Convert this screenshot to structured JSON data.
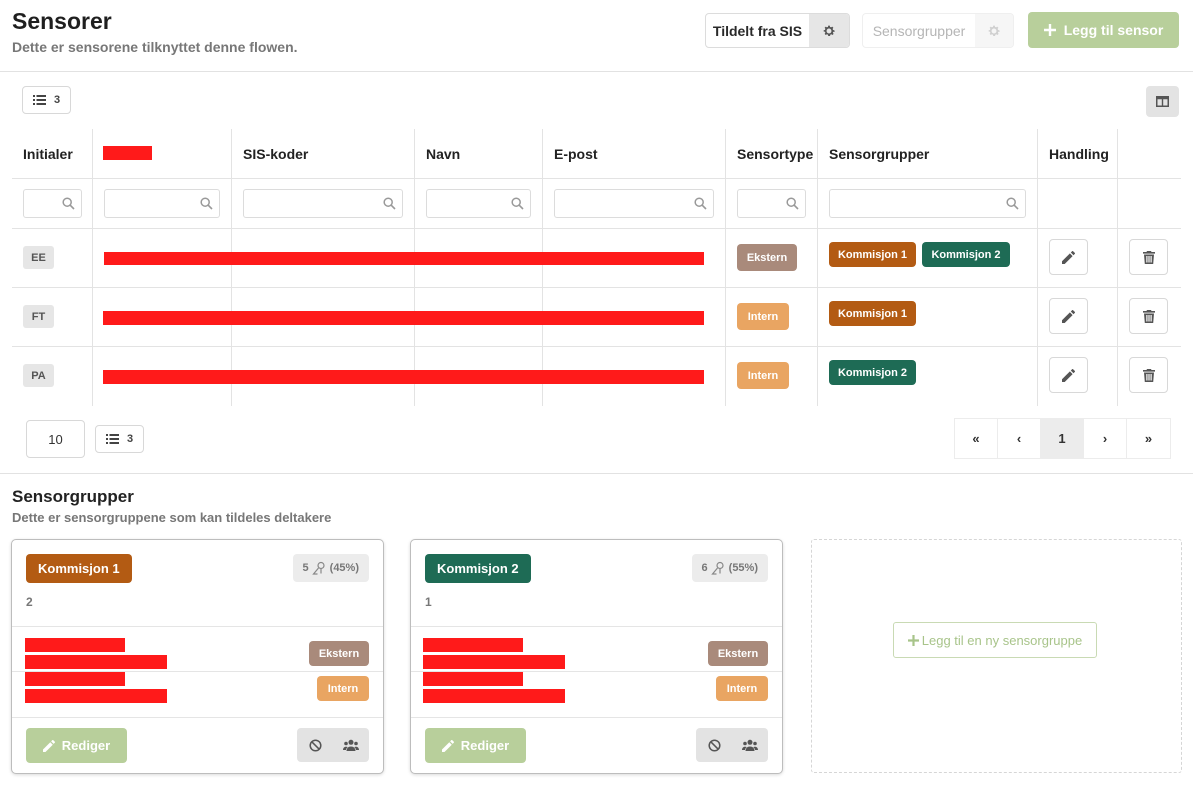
{
  "header": {
    "title": "Sensorer",
    "subtitle": "Dette er sensorene tilknyttet denne flowen.",
    "assign_sis_label": "Tildelt fra SIS",
    "sensor_groups_label": "Sensorgrupper",
    "add_sensor_label": "Legg til sensor"
  },
  "toolbar": {
    "row_count": "3"
  },
  "table": {
    "columns": [
      "Initialer",
      "",
      "SIS-koder",
      "Navn",
      "E-post",
      "Sensortype",
      "Sensorgrupper",
      "Handling"
    ],
    "rows": [
      {
        "initials": "EE",
        "type": "Ekstern",
        "groups": [
          "Kommisjon 1",
          "Kommisjon 2"
        ]
      },
      {
        "initials": "FT",
        "type": "Intern",
        "groups": [
          "Kommisjon 1"
        ]
      },
      {
        "initials": "PA",
        "type": "Intern",
        "groups": [
          "Kommisjon 2"
        ]
      }
    ]
  },
  "pagination": {
    "page_size": "10",
    "row_count": "3",
    "first": "«",
    "prev": "‹",
    "current": "1",
    "next": "›",
    "last": "»"
  },
  "groups_section": {
    "title": "Sensorgrupper",
    "subtitle": "Dette er sensorgruppene som kan tildeles deltakere",
    "cards": [
      {
        "name": "Kommisjon 1",
        "share_count": "5",
        "share_pct": "(45%)",
        "member_count": "2",
        "members": [
          "Ekstern",
          "Intern"
        ],
        "edit_label": "Rediger",
        "color": "#b35b13"
      },
      {
        "name": "Kommisjon 2",
        "share_count": "6",
        "share_pct": "(55%)",
        "member_count": "1",
        "members": [
          "Ekstern",
          "Intern"
        ],
        "edit_label": "Rediger",
        "color": "#1e6b55"
      }
    ],
    "add_group_label": "Legg til en ny sensorgruppe"
  },
  "colors": {
    "accent_green": "#b8cf9b",
    "ekstern": "#a98a7b",
    "intern": "#e9a562",
    "kommisjon_1": "#b35b13",
    "kommisjon_2": "#1e6b55"
  }
}
